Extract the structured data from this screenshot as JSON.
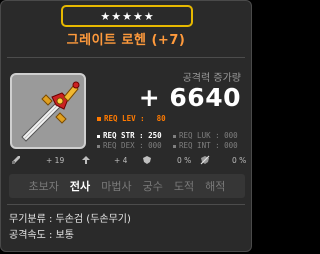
{
  "item": {
    "stars": [
      "★",
      "★",
      "★",
      "★",
      "★"
    ],
    "name": "그레이트 로헨 (+7)"
  },
  "power": {
    "label": "공격력 증가량",
    "value": "+ 6640"
  },
  "requirements": {
    "level": {
      "label": "REQ LEV :",
      "value": "80"
    },
    "str": {
      "label": "REQ STR : 250"
    },
    "dex": {
      "label": "REQ DEX : 000"
    },
    "luk": {
      "label": "REQ LUK : 000"
    },
    "int": {
      "label": "REQ INT : 000"
    }
  },
  "stats": [
    {
      "icon": "attack-icon",
      "value": "+ 19"
    },
    {
      "icon": "upgrade-icon",
      "value": "+ 4"
    },
    {
      "icon": "defense-icon",
      "value": "0 %"
    },
    {
      "icon": "ignore-defense-icon",
      "value": "0 %"
    }
  ],
  "jobs": [
    {
      "label": "초보자",
      "active": false
    },
    {
      "label": "전사",
      "active": true
    },
    {
      "label": "마법사",
      "active": false
    },
    {
      "label": "궁수",
      "active": false
    },
    {
      "label": "도적",
      "active": false
    },
    {
      "label": "해적",
      "active": false
    }
  ],
  "info": {
    "category": "무기분류 : 두손검 (두손무기)",
    "speed": "공격속도 : 보통"
  },
  "colors": {
    "title": "#ff9a3c",
    "star_border": "#e6b800",
    "req_level": "#ff7a00",
    "req_met": "#ffffff",
    "req_unmet": "#7f7f7f"
  }
}
